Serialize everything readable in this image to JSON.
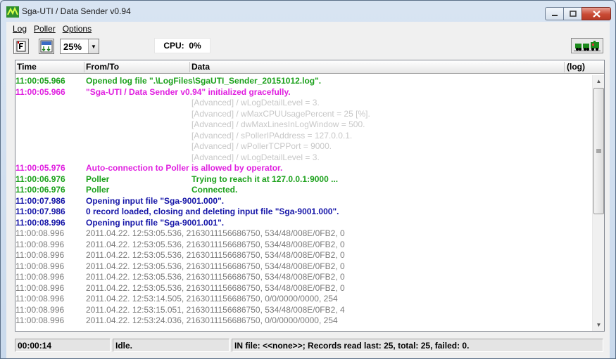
{
  "window": {
    "title": "Sga-UTI / Data Sender  v0.94"
  },
  "menu": {
    "items": [
      "Log",
      "Poller",
      "Options"
    ]
  },
  "toolbar": {
    "zoom": "25%",
    "cpu_label": "CPU:",
    "cpu_value": "0%"
  },
  "columns": {
    "time": "Time",
    "from": "From/To",
    "data": "Data",
    "log": "(log)"
  },
  "rows": [
    {
      "time": "11:00:05.966",
      "from": "",
      "data": "Opened log file \".\\LogFiles\\SgaUTI_Sender_20151012.log\".",
      "style": "green",
      "span": true
    },
    {
      "time": "11:00:05.966",
      "from": "",
      "data": "\"Sga-UTI / Data Sender  v0.94\" initialized gracefully.",
      "style": "magenta",
      "span": true
    },
    {
      "time": "",
      "from": "",
      "data": "[Advanced] / wLogDetailLevel = 3.",
      "style": "light"
    },
    {
      "time": "",
      "from": "",
      "data": "[Advanced] / wMaxCPUUsagePercent = 25 [%].",
      "style": "light"
    },
    {
      "time": "",
      "from": "",
      "data": "[Advanced] / dwMaxLinesInLogWindow = 500.",
      "style": "light"
    },
    {
      "time": "",
      "from": "",
      "data": "[Advanced] / sPollerIPAddress = 127.0.0.1.",
      "style": "light"
    },
    {
      "time": "",
      "from": "",
      "data": "[Advanced] / wPollerTCPPort = 9000.",
      "style": "light"
    },
    {
      "time": "",
      "from": "",
      "data": "[Advanced] / wLogDetailLevel = 3.",
      "style": "light"
    },
    {
      "time": "11:00:05.976",
      "from": "",
      "data": "Auto-connection to Poller is allowed by operator.",
      "style": "magenta",
      "span": true
    },
    {
      "time": "11:00:06.976",
      "from": "Poller",
      "data": "Trying to reach it at 127.0.0.1:9000 ...",
      "style": "green"
    },
    {
      "time": "11:00:06.976",
      "from": "Poller",
      "data": "Connected.",
      "style": "green"
    },
    {
      "time": "11:00:07.986",
      "from": "",
      "data": "Opening input file \"Sga-9001.000\".",
      "style": "blue",
      "span": true
    },
    {
      "time": "11:00:07.986",
      "from": "",
      "data": "0 record loaded, closing and deleting input file \"Sga-9001.000\".",
      "style": "blue",
      "span": true
    },
    {
      "time": "11:00:08.996",
      "from": "",
      "data": "Opening input file \"Sga-9001.001\".",
      "style": "blue",
      "span": true
    },
    {
      "time": "11:00:08.996",
      "from": "",
      "data": "2011.04.22. 12:53:05.536, 2163011156686750, 534/48/008E/0FB2, 0",
      "style": "gray",
      "span": true
    },
    {
      "time": "11:00:08.996",
      "from": "",
      "data": "2011.04.22. 12:53:05.536, 2163011156686750, 534/48/008E/0FB2, 0",
      "style": "gray",
      "span": true
    },
    {
      "time": "11:00:08.996",
      "from": "",
      "data": "2011.04.22. 12:53:05.536, 2163011156686750, 534/48/008E/0FB2, 0",
      "style": "gray",
      "span": true
    },
    {
      "time": "11:00:08.996",
      "from": "",
      "data": "2011.04.22. 12:53:05.536, 2163011156686750, 534/48/008E/0FB2, 0",
      "style": "gray",
      "span": true
    },
    {
      "time": "11:00:08.996",
      "from": "",
      "data": "2011.04.22. 12:53:05.536, 2163011156686750, 534/48/008E/0FB2, 0",
      "style": "gray",
      "span": true
    },
    {
      "time": "11:00:08.996",
      "from": "",
      "data": "2011.04.22. 12:53:05.536, 2163011156686750, 534/48/008E/0FB2, 0",
      "style": "gray",
      "span": true
    },
    {
      "time": "11:00:08.996",
      "from": "",
      "data": "2011.04.22. 12:53:14.505, 2163011156686750, 0/0/0000/0000, 254",
      "style": "gray",
      "span": true
    },
    {
      "time": "11:00:08.996",
      "from": "",
      "data": "2011.04.22. 12:53:15.051, 2163011156686750, 534/48/008E/0FB2, 4",
      "style": "gray",
      "span": true
    },
    {
      "time": "11:00:08.996",
      "from": "",
      "data": "2011.04.22. 12:53:24.036, 2163011156686750, 0/0/0000/0000, 254",
      "style": "gray",
      "span": true
    }
  ],
  "status": {
    "elapsed": "00:00:14",
    "state": "Idle.",
    "info": "IN file: <<none>>;  Records read last: 25,  total: 25,  failed: 0."
  },
  "colors": {
    "green": "#1ca11c",
    "magenta": "#e020e0",
    "blue": "#1515a8",
    "gray": "#7a7a7a",
    "light": "#c8c8c8"
  },
  "icons": [
    "app-icon",
    "minimize-icon",
    "maximize-icon",
    "close-icon",
    "log-file-icon",
    "auto-scroll-icon",
    "dropdown-arrow-icon",
    "train-icon",
    "scroll-up-icon",
    "scroll-down-icon"
  ]
}
